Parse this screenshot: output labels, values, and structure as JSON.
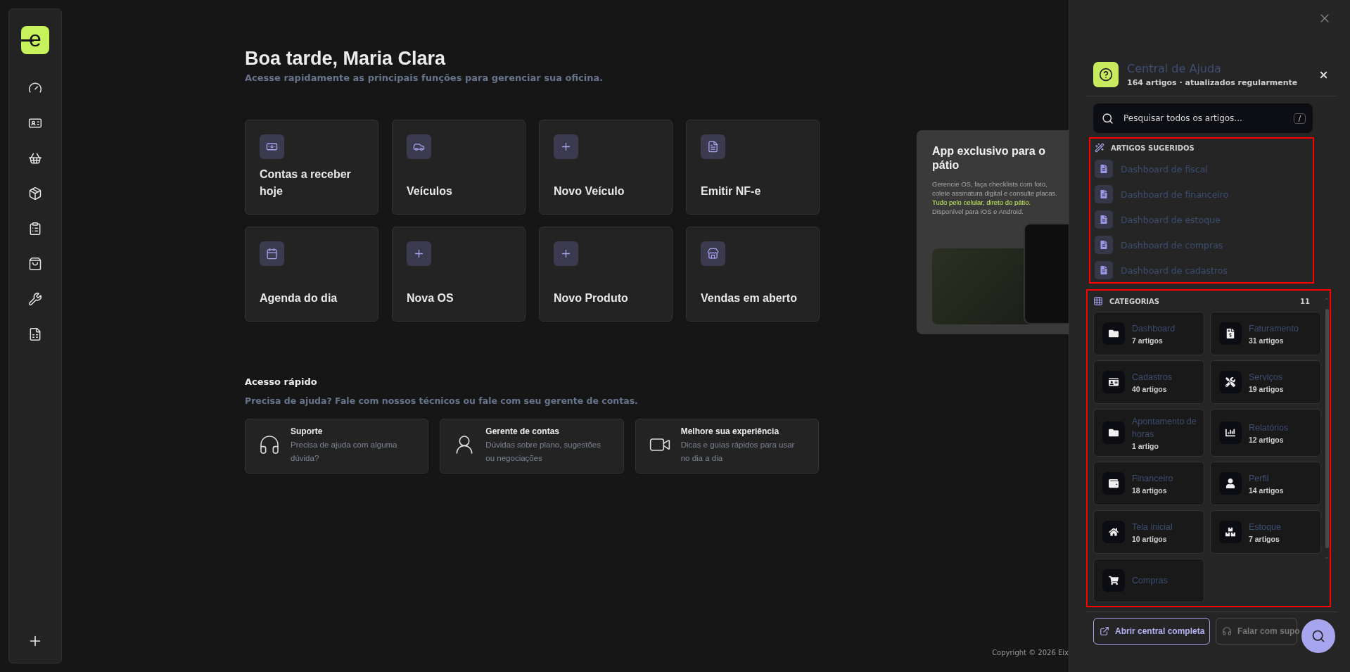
{
  "logo": {
    "text": "e"
  },
  "greeting": {
    "title": "Boa tarde, Maria Clara",
    "subtitle": "Acesse rapidamente as principais funções para gerenciar sua oficina."
  },
  "shortcuts": [
    {
      "label": "Contas a receber hoje"
    },
    {
      "label": "Veículos"
    },
    {
      "label": "Novo Veículo"
    },
    {
      "label": "Emitir NF-e"
    },
    {
      "label": "Agenda do dia"
    },
    {
      "label": "Nova OS"
    },
    {
      "label": "Novo Produto"
    },
    {
      "label": "Vendas em aberto"
    }
  ],
  "promo": {
    "title": "App exclusivo para o pátio",
    "body": "Gerencie OS, faça checklists com foto, colete assinatura digital e consulte placas. **Tudo pelo celular, direto do pátio.** Disponível para iOS e Android."
  },
  "quick_access": {
    "title": "Acesso rápido",
    "subtitle": "Precisa de ajuda? Fale com nossos técnicos ou fale com seu gerente de contas.",
    "cards": [
      {
        "title": "Suporte",
        "description": "Precisa de ajuda com alguma dúvida?"
      },
      {
        "title": "Gerente de contas",
        "description": "Dúvidas sobre plano, sugestões ou negociações"
      },
      {
        "title": "Melhore sua experiência",
        "description": "Dicas e guias rápidos para usar no dia a dia"
      }
    ]
  },
  "footer": {
    "copyright": "Copyright © 2026 Eix"
  },
  "help_panel": {
    "title": "Central de Ajuda",
    "subtitle": "164 artigos · atualizados regularmente",
    "search": {
      "placeholder": "Pesquisar todos os artigos...",
      "shortcut": "/"
    },
    "suggested": {
      "heading": "ARTIGOS SUGERIDOS",
      "articles": [
        "Dashboard de fiscal",
        "Dashboard de financeiro",
        "Dashboard de estoque",
        "Dashboard de compras",
        "Dashboard de cadastros"
      ]
    },
    "categories": {
      "heading": "CATEGORIAS",
      "count": "11",
      "items": [
        {
          "name": "Dashboard",
          "count": "7 artigos"
        },
        {
          "name": "Faturamento",
          "count": "31 artigos"
        },
        {
          "name": "Cadastros",
          "count": "40 artigos"
        },
        {
          "name": "Serviços",
          "count": "19 artigos"
        },
        {
          "name": "Apontamento de horas",
          "count": "1 artigo"
        },
        {
          "name": "Relatórios",
          "count": "12 artigos"
        },
        {
          "name": "Financeiro",
          "count": "18 artigos"
        },
        {
          "name": "Perfil",
          "count": "14 artigos"
        },
        {
          "name": "Tela inicial",
          "count": "10 artigos"
        },
        {
          "name": "Estoque",
          "count": "7 artigos"
        },
        {
          "name": "Compras"
        }
      ]
    },
    "buttons": [
      {
        "kind": "primary",
        "label": "Abrir central completa"
      },
      {
        "kind": "secondary",
        "label": "Falar com supo"
      }
    ]
  }
}
